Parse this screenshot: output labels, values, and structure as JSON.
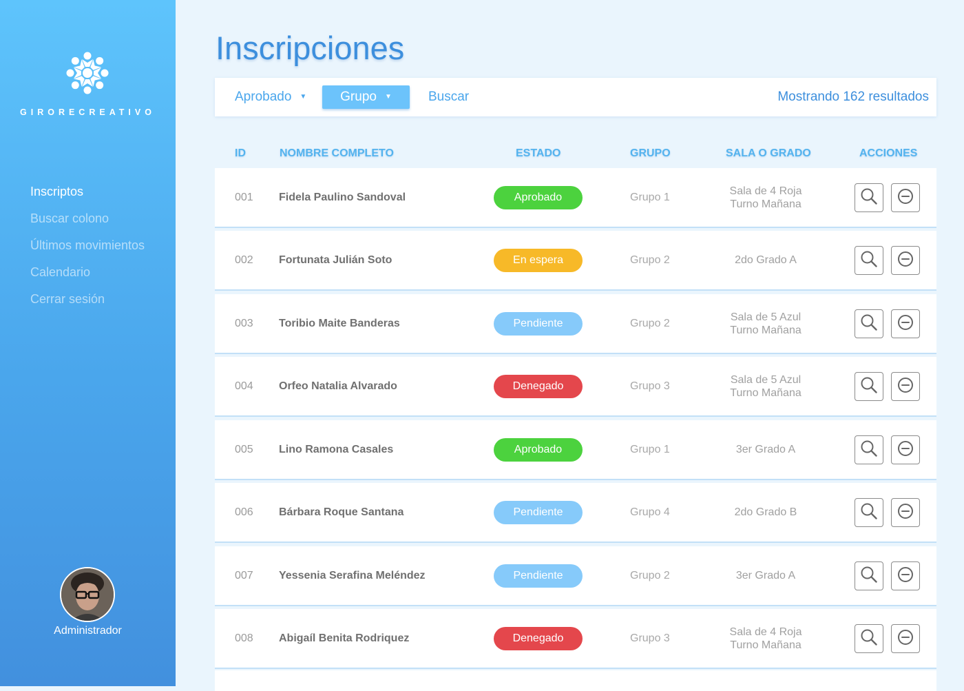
{
  "sidebar": {
    "brand": "GIRORECREATIVO",
    "nav": [
      "Inscriptos",
      "Buscar colono",
      "Últimos movimientos",
      "Calendario",
      "Cerrar sesión"
    ],
    "active_index": 0,
    "user_label": "Administrador"
  },
  "page": {
    "title": "Inscripciones"
  },
  "filters": {
    "aprobado": "Aprobado",
    "grupo": "Grupo",
    "buscar": "Buscar",
    "results": "Mostrando 162 resultados"
  },
  "table": {
    "headers": {
      "id": "ID",
      "name": "NOMBRE COMPLETO",
      "status": "ESTADO",
      "group": "GRUPO",
      "sala": "SALA O GRADO",
      "actions": "ACCIONES"
    },
    "rows": [
      {
        "id": "001",
        "name": "Fidela Paulino Sandoval",
        "status": "Aprobado",
        "group": "Grupo 1",
        "sala1": "Sala de 4 Roja",
        "sala2": "Turno Mañana"
      },
      {
        "id": "002",
        "name": "Fortunata Julián Soto",
        "status": "En espera",
        "group": "Grupo 2",
        "sala1": "2do Grado A",
        "sala2": ""
      },
      {
        "id": "003",
        "name": "Toribio Maite Banderas",
        "status": "Pendiente",
        "group": "Grupo 2",
        "sala1": "Sala de 5 Azul",
        "sala2": "Turno Mañana"
      },
      {
        "id": "004",
        "name": "Orfeo Natalia Alvarado",
        "status": "Denegado",
        "group": "Grupo 3",
        "sala1": "Sala de 5 Azul",
        "sala2": "Turno Mañana"
      },
      {
        "id": "005",
        "name": "Lino Ramona Casales",
        "status": "Aprobado",
        "group": "Grupo 1",
        "sala1": "3er Grado A",
        "sala2": ""
      },
      {
        "id": "006",
        "name": "Bárbara Roque Santana",
        "status": "Pendiente",
        "group": "Grupo 4",
        "sala1": "2do Grado B",
        "sala2": ""
      },
      {
        "id": "007",
        "name": "Yessenia Serafina Meléndez",
        "status": "Pendiente",
        "group": "Grupo 2",
        "sala1": "3er Grado A",
        "sala2": ""
      },
      {
        "id": "008",
        "name": "Abigaíl Benita Rodriquez",
        "status": "Denegado",
        "group": "Grupo 3",
        "sala1": "Sala de 4 Roja",
        "sala2": "Turno Mañana"
      }
    ]
  },
  "status_colors": {
    "Aprobado": "#4cd23e",
    "En espera": "#f7b928",
    "Pendiente": "#86cafa",
    "Denegado": "#e4474c"
  },
  "icons": {
    "logo": "flower-logo-icon",
    "search": "search-icon",
    "remove": "minus-circle-icon"
  }
}
